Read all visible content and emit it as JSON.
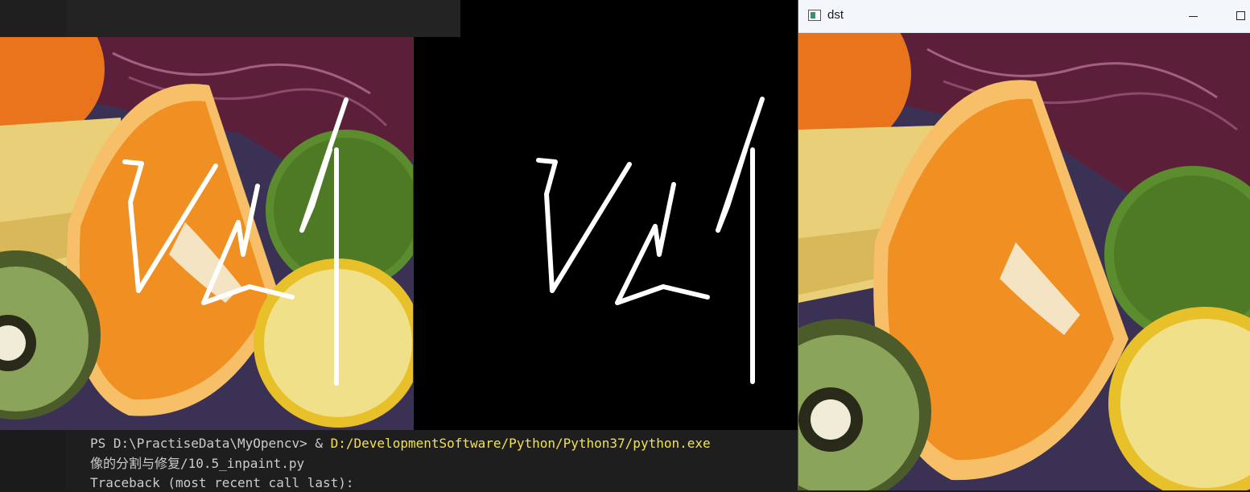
{
  "terminal": {
    "prompt": "PS D:\\PractiseData\\MyOpencv> & ",
    "command_path": "D:/DevelopmentSoftware/Python/Python37/python.exe",
    "line2": "像的分割与修复/10.5_inpaint.py",
    "line3": "Traceback (most recent call last):"
  },
  "dst_window": {
    "title": "dst"
  },
  "colors": {
    "editor_bg": "#181818",
    "terminal_text": "#cccccc",
    "terminal_path": "#f2e34b",
    "titlebar": "#f3f6fb"
  }
}
